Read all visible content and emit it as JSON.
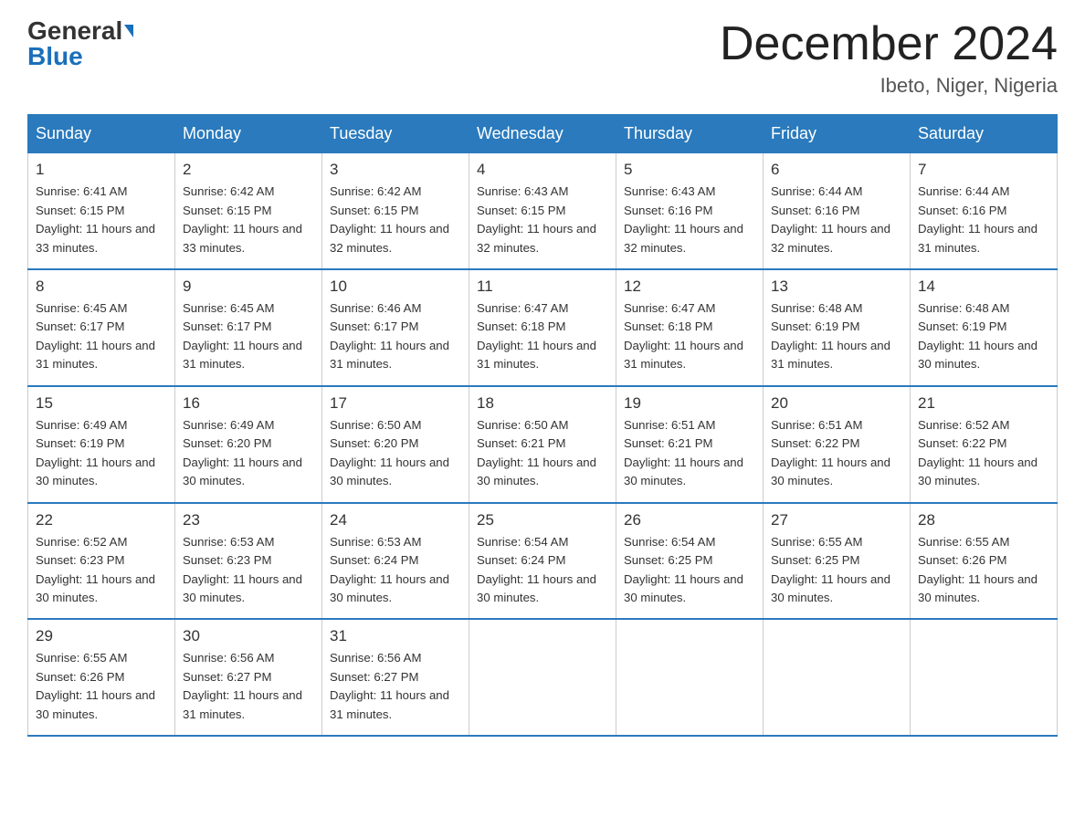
{
  "logo": {
    "general": "General",
    "blue": "Blue"
  },
  "title": "December 2024",
  "location": "Ibeto, Niger, Nigeria",
  "days_of_week": [
    "Sunday",
    "Monday",
    "Tuesday",
    "Wednesday",
    "Thursday",
    "Friday",
    "Saturday"
  ],
  "weeks": [
    [
      {
        "day": "1",
        "sunrise": "6:41 AM",
        "sunset": "6:15 PM",
        "daylight": "11 hours and 33 minutes."
      },
      {
        "day": "2",
        "sunrise": "6:42 AM",
        "sunset": "6:15 PM",
        "daylight": "11 hours and 33 minutes."
      },
      {
        "day": "3",
        "sunrise": "6:42 AM",
        "sunset": "6:15 PM",
        "daylight": "11 hours and 32 minutes."
      },
      {
        "day": "4",
        "sunrise": "6:43 AM",
        "sunset": "6:15 PM",
        "daylight": "11 hours and 32 minutes."
      },
      {
        "day": "5",
        "sunrise": "6:43 AM",
        "sunset": "6:16 PM",
        "daylight": "11 hours and 32 minutes."
      },
      {
        "day": "6",
        "sunrise": "6:44 AM",
        "sunset": "6:16 PM",
        "daylight": "11 hours and 32 minutes."
      },
      {
        "day": "7",
        "sunrise": "6:44 AM",
        "sunset": "6:16 PM",
        "daylight": "11 hours and 31 minutes."
      }
    ],
    [
      {
        "day": "8",
        "sunrise": "6:45 AM",
        "sunset": "6:17 PM",
        "daylight": "11 hours and 31 minutes."
      },
      {
        "day": "9",
        "sunrise": "6:45 AM",
        "sunset": "6:17 PM",
        "daylight": "11 hours and 31 minutes."
      },
      {
        "day": "10",
        "sunrise": "6:46 AM",
        "sunset": "6:17 PM",
        "daylight": "11 hours and 31 minutes."
      },
      {
        "day": "11",
        "sunrise": "6:47 AM",
        "sunset": "6:18 PM",
        "daylight": "11 hours and 31 minutes."
      },
      {
        "day": "12",
        "sunrise": "6:47 AM",
        "sunset": "6:18 PM",
        "daylight": "11 hours and 31 minutes."
      },
      {
        "day": "13",
        "sunrise": "6:48 AM",
        "sunset": "6:19 PM",
        "daylight": "11 hours and 31 minutes."
      },
      {
        "day": "14",
        "sunrise": "6:48 AM",
        "sunset": "6:19 PM",
        "daylight": "11 hours and 30 minutes."
      }
    ],
    [
      {
        "day": "15",
        "sunrise": "6:49 AM",
        "sunset": "6:19 PM",
        "daylight": "11 hours and 30 minutes."
      },
      {
        "day": "16",
        "sunrise": "6:49 AM",
        "sunset": "6:20 PM",
        "daylight": "11 hours and 30 minutes."
      },
      {
        "day": "17",
        "sunrise": "6:50 AM",
        "sunset": "6:20 PM",
        "daylight": "11 hours and 30 minutes."
      },
      {
        "day": "18",
        "sunrise": "6:50 AM",
        "sunset": "6:21 PM",
        "daylight": "11 hours and 30 minutes."
      },
      {
        "day": "19",
        "sunrise": "6:51 AM",
        "sunset": "6:21 PM",
        "daylight": "11 hours and 30 minutes."
      },
      {
        "day": "20",
        "sunrise": "6:51 AM",
        "sunset": "6:22 PM",
        "daylight": "11 hours and 30 minutes."
      },
      {
        "day": "21",
        "sunrise": "6:52 AM",
        "sunset": "6:22 PM",
        "daylight": "11 hours and 30 minutes."
      }
    ],
    [
      {
        "day": "22",
        "sunrise": "6:52 AM",
        "sunset": "6:23 PM",
        "daylight": "11 hours and 30 minutes."
      },
      {
        "day": "23",
        "sunrise": "6:53 AM",
        "sunset": "6:23 PM",
        "daylight": "11 hours and 30 minutes."
      },
      {
        "day": "24",
        "sunrise": "6:53 AM",
        "sunset": "6:24 PM",
        "daylight": "11 hours and 30 minutes."
      },
      {
        "day": "25",
        "sunrise": "6:54 AM",
        "sunset": "6:24 PM",
        "daylight": "11 hours and 30 minutes."
      },
      {
        "day": "26",
        "sunrise": "6:54 AM",
        "sunset": "6:25 PM",
        "daylight": "11 hours and 30 minutes."
      },
      {
        "day": "27",
        "sunrise": "6:55 AM",
        "sunset": "6:25 PM",
        "daylight": "11 hours and 30 minutes."
      },
      {
        "day": "28",
        "sunrise": "6:55 AM",
        "sunset": "6:26 PM",
        "daylight": "11 hours and 30 minutes."
      }
    ],
    [
      {
        "day": "29",
        "sunrise": "6:55 AM",
        "sunset": "6:26 PM",
        "daylight": "11 hours and 30 minutes."
      },
      {
        "day": "30",
        "sunrise": "6:56 AM",
        "sunset": "6:27 PM",
        "daylight": "11 hours and 31 minutes."
      },
      {
        "day": "31",
        "sunrise": "6:56 AM",
        "sunset": "6:27 PM",
        "daylight": "11 hours and 31 minutes."
      },
      null,
      null,
      null,
      null
    ]
  ]
}
